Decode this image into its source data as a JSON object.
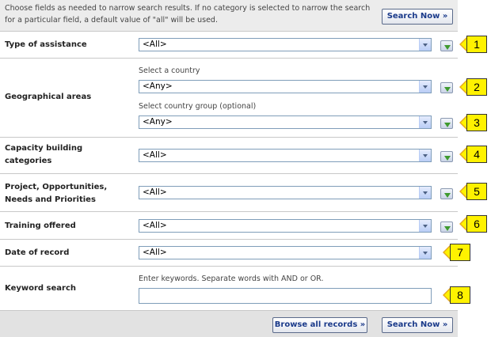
{
  "intro": "Choose fields as needed to narrow search results. If no category is selected to narrow the search for a particular field, a default value of \"all\" will be used.",
  "buttons": {
    "search_now": "Search Now »",
    "browse_all": "Browse all records »"
  },
  "fields": {
    "type_of_assistance": {
      "label": "Type of assistance",
      "value": "<All>"
    },
    "geographical_areas": {
      "label": "Geographical areas",
      "country_hint": "Select a country",
      "country_value": "<Any>",
      "group_hint": "Select country group (optional)",
      "group_value": "<Any>"
    },
    "capacity_building": {
      "label": "Capacity building categories",
      "value": "<All>"
    },
    "project_opportunities": {
      "label": "Project, Opportunities, Needs and Priorities",
      "value": "<All>"
    },
    "training_offered": {
      "label": "Training offered",
      "value": "<All>"
    },
    "date_of_record": {
      "label": "Date of record",
      "value": "<All>"
    },
    "keyword_search": {
      "label": "Keyword search",
      "hint": "Enter keywords. Separate words with AND or OR.",
      "value": ""
    }
  },
  "callouts": [
    "1",
    "2",
    "3",
    "4",
    "5",
    "6",
    "7",
    "8"
  ],
  "icons": {
    "add_selection": "add-selection-icon",
    "dropdown": "dropdown-arrow-icon"
  },
  "colors": {
    "callout_fill": "#fff200",
    "button_text": "#1a3a8a",
    "panel_bg": "#ececec"
  }
}
